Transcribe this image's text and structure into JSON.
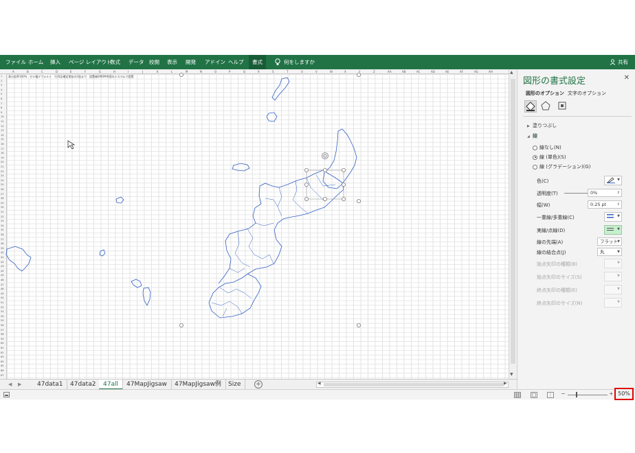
{
  "ribbon": {
    "tabs": [
      "ファイル",
      "ホーム",
      "挿入",
      "ページ レイアウト",
      "数式",
      "データ",
      "校閲",
      "表示",
      "開発",
      "アドイン",
      "ヘルプ",
      "書式"
    ],
    "active_tab": "書式",
    "tell_me": "何をしますか",
    "share": "共有"
  },
  "sheet": {
    "columns": [
      "A",
      "B",
      "C",
      "D",
      "E",
      "F",
      "G",
      "H",
      "I",
      "J",
      "K",
      "L",
      "M",
      "N",
      "O",
      "P",
      "Q",
      "R",
      "S",
      "T",
      "U",
      "V",
      "W",
      "X",
      "Y",
      "Z",
      "AA",
      "AB",
      "AC",
      "AD",
      "AE",
      "AF",
      "AG",
      "AH"
    ],
    "note": "表示倍率100%　セル幅デフォルト　行列比確定保存の2倍まで　設置者EMOM中国のシステムで設置"
  },
  "sheet_tabs": {
    "tabs": [
      "47data1",
      "47data2",
      "47all",
      "47MapJigsaw",
      "47MapJigsaw例",
      "Size"
    ],
    "active": "47all"
  },
  "pane": {
    "title": "図形の書式設定",
    "tab_shape": "図形のオプション",
    "tab_text": "文字のオプション",
    "section_fill": "塗りつぶし",
    "section_line": "線",
    "radio_none": "線なし(N)",
    "radio_solid": "線 (単色)(S)",
    "radio_gradient": "線 (グラデーション)(G)",
    "color_label": "色(C)",
    "transparency_label": "透明度(T)",
    "transparency_value": "0%",
    "width_label": "幅(W)",
    "width_value": "0.25 pt",
    "compound_label": "一重線/多重線(C)",
    "dash_label": "実線/点線(D)",
    "cap_label": "線の先端(A)",
    "cap_value": "フラット",
    "join_label": "線の結合点(J)",
    "join_value": "丸",
    "begin_arrow_type": "始点矢印の種類(B)",
    "begin_arrow_size": "始点矢印のサイズ(S)",
    "end_arrow_type": "終点矢印の種類(E)",
    "end_arrow_size": "終点矢印のサイズ(N)"
  },
  "status": {
    "zoom": "50%"
  },
  "colors": {
    "excel_green": "#217346",
    "map_outline": "#2f5fc4",
    "zoom_highlight": "#e00000"
  }
}
